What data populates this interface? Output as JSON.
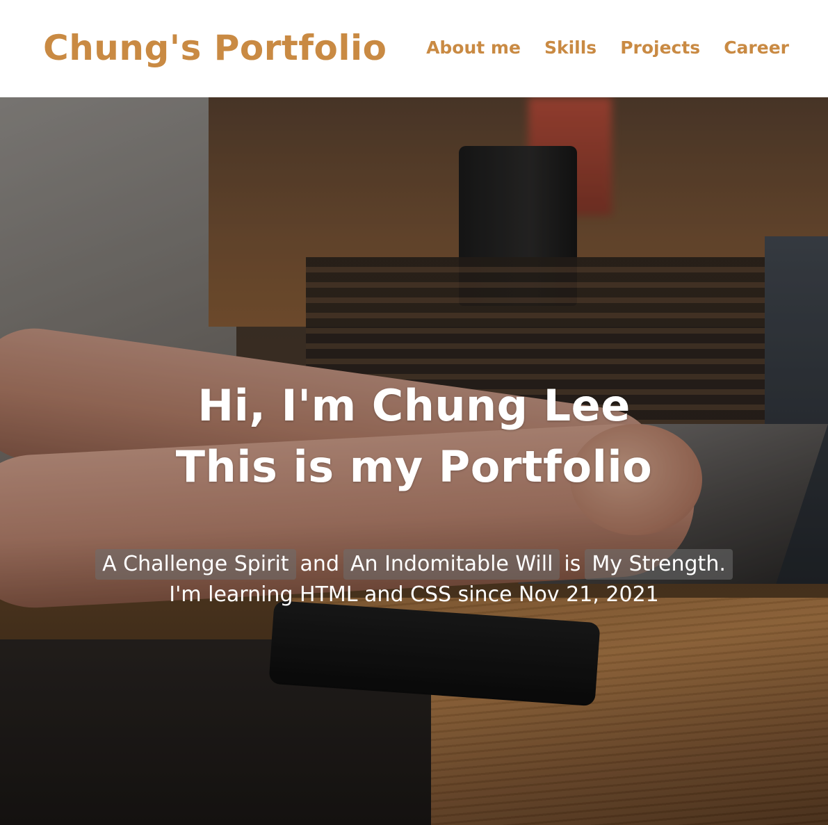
{
  "header": {
    "logo": "Chung's Portfolio",
    "nav": [
      {
        "label": "About me"
      },
      {
        "label": "Skills"
      },
      {
        "label": "Projects"
      },
      {
        "label": "Career"
      }
    ]
  },
  "hero": {
    "title_line1": "Hi, I'm Chung Lee",
    "title_line2": "This is my Portfolio",
    "tagline": {
      "part1": "A Challenge Spirit",
      "conj1": "and",
      "part2": "An Indomitable Will",
      "conj2": "is",
      "part3": "My Strength."
    },
    "learning_note": "I'm learning HTML and CSS since Nov 21, 2021"
  },
  "colors": {
    "brand": "#c98a43",
    "hero_text": "#ffffff",
    "highlight_bg": "#6e6e6e"
  }
}
